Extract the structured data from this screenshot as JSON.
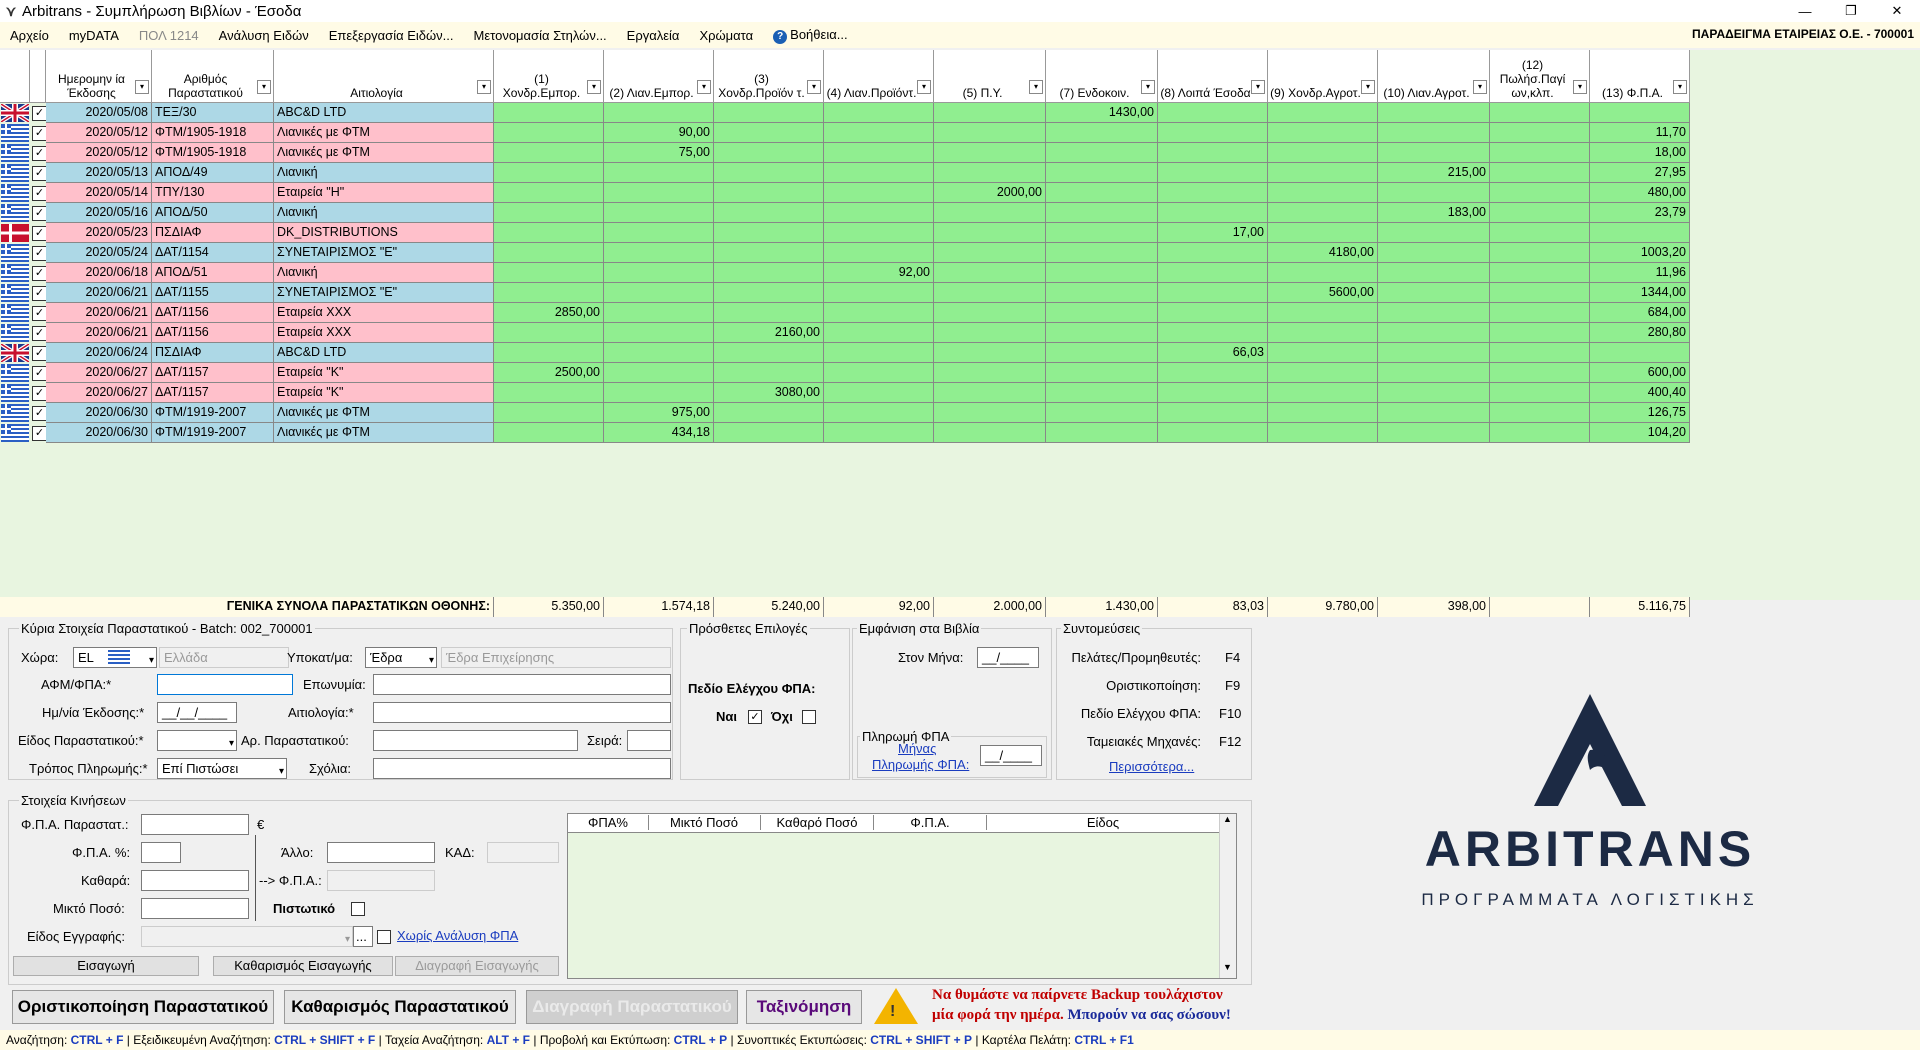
{
  "window": {
    "title": "Arbitrans - Συμπλήρωση Βιβλίων - Έσοδα",
    "minimize": "—",
    "maximize": "❐",
    "close": "✕"
  },
  "menu": [
    "Αρχείο",
    "myDATA",
    "ΠΟΛ 1214",
    "Ανάλυση Ειδών",
    "Επεξεργασία Ειδών...",
    "Μετονομασία Στηλών...",
    "Εργαλεία",
    "Χρώματα",
    "Βοήθεια..."
  ],
  "company": "ΠΑΡΑΔΕΙΓΜΑ ΕΤΑΙΡΕΙΑΣ Ο.Ε. - 700001",
  "grid": {
    "headers": [
      "Ημερομην ία Έκδοσης",
      "Αριθμός Παραστατικού",
      "Αιτιολογία",
      "(1) Χονδρ.Εμπορ.",
      "(2) Λιαν.Εμπορ.",
      "(3) Χονδρ.Προϊόν τ.",
      "(4) Λιαν.Προϊόντ.",
      "(5) Π.Υ.",
      "(7) Ενδοκοιν.",
      "(8) Λοιπά Έσοδα",
      "(9) Χονδρ.Αγροτ.",
      "(10) Λιαν.Αγροτ.",
      "(12) Πωλήσ.Παγί ων,κλπ.",
      "(13) Φ.Π.Α."
    ],
    "rows": [
      {
        "flag": "gb",
        "date": "2020/05/08",
        "doc": "ΤΕΞ/30",
        "desc": "ABC&D LTD",
        "vals": [
          "",
          "",
          "",
          "",
          "",
          "1430,00",
          "",
          "",
          "",
          "",
          ""
        ],
        "color": "blue"
      },
      {
        "flag": "gr",
        "date": "2020/05/12",
        "doc": "ΦΤΜ/1905-1918",
        "desc": "Λιανικές με ΦΤΜ",
        "vals": [
          "",
          "90,00",
          "",
          "",
          "",
          "",
          "",
          "",
          "",
          "",
          "11,70"
        ],
        "color": "pink"
      },
      {
        "flag": "gr",
        "date": "2020/05/12",
        "doc": "ΦΤΜ/1905-1918",
        "desc": "Λιανικές με ΦΤΜ",
        "vals": [
          "",
          "75,00",
          "",
          "",
          "",
          "",
          "",
          "",
          "",
          "",
          "18,00"
        ],
        "color": "pink"
      },
      {
        "flag": "gr",
        "date": "2020/05/13",
        "doc": "ΑΠΟΔ/49",
        "desc": "Λιανική",
        "vals": [
          "",
          "",
          "",
          "",
          "",
          "",
          "",
          "",
          "215,00",
          "",
          "27,95"
        ],
        "color": "blue"
      },
      {
        "flag": "gr",
        "date": "2020/05/14",
        "doc": "ΤΠΥ/130",
        "desc": "Εταιρεία \"Η\"",
        "vals": [
          "",
          "",
          "",
          "",
          "2000,00",
          "",
          "",
          "",
          "",
          "",
          "480,00"
        ],
        "color": "pink"
      },
      {
        "flag": "gr",
        "date": "2020/05/16",
        "doc": "ΑΠΟΔ/50",
        "desc": "Λιανική",
        "vals": [
          "",
          "",
          "",
          "",
          "",
          "",
          "",
          "",
          "183,00",
          "",
          "23,79"
        ],
        "color": "blue"
      },
      {
        "flag": "dk",
        "date": "2020/05/23",
        "doc": "ΠΣΔΙΑΦ",
        "desc": "DK_DISTRIBUTIONS",
        "vals": [
          "",
          "",
          "",
          "",
          "",
          "",
          "17,00",
          "",
          "",
          "",
          ""
        ],
        "color": "pink"
      },
      {
        "flag": "gr",
        "date": "2020/05/24",
        "doc": "ΔΑΤ/1154",
        "desc": "ΣΥΝΕΤΑΙΡΙΣΜΟΣ \"Ε\"",
        "vals": [
          "",
          "",
          "",
          "",
          "",
          "",
          "",
          "4180,00",
          "",
          "",
          "1003,20"
        ],
        "color": "blue"
      },
      {
        "flag": "gr",
        "date": "2020/06/18",
        "doc": "ΑΠΟΔ/51",
        "desc": "Λιανική",
        "vals": [
          "",
          "",
          "",
          "92,00",
          "",
          "",
          "",
          "",
          "",
          "",
          "11,96"
        ],
        "color": "pink"
      },
      {
        "flag": "gr",
        "date": "2020/06/21",
        "doc": "ΔΑΤ/1155",
        "desc": "ΣΥΝΕΤΑΙΡΙΣΜΟΣ \"Ε\"",
        "vals": [
          "",
          "",
          "",
          "",
          "",
          "",
          "",
          "5600,00",
          "",
          "",
          "1344,00"
        ],
        "color": "blue"
      },
      {
        "flag": "gr",
        "date": "2020/06/21",
        "doc": "ΔΑΤ/1156",
        "desc": "Εταιρεία ΧΧΧ",
        "vals": [
          "2850,00",
          "",
          "",
          "",
          "",
          "",
          "",
          "",
          "",
          "",
          "684,00"
        ],
        "color": "pink"
      },
      {
        "flag": "gr",
        "date": "2020/06/21",
        "doc": "ΔΑΤ/1156",
        "desc": "Εταιρεία ΧΧΧ",
        "vals": [
          "",
          "",
          "2160,00",
          "",
          "",
          "",
          "",
          "",
          "",
          "",
          "280,80"
        ],
        "color": "pink"
      },
      {
        "flag": "gb",
        "date": "2020/06/24",
        "doc": "ΠΣΔΙΑΦ",
        "desc": "ABC&D LTD",
        "vals": [
          "",
          "",
          "",
          "",
          "",
          "",
          "66,03",
          "",
          "",
          "",
          ""
        ],
        "color": "blue"
      },
      {
        "flag": "gr",
        "date": "2020/06/27",
        "doc": "ΔΑΤ/1157",
        "desc": "Εταιρεία \"Κ\"",
        "vals": [
          "2500,00",
          "",
          "",
          "",
          "",
          "",
          "",
          "",
          "",
          "",
          "600,00"
        ],
        "color": "pink"
      },
      {
        "flag": "gr",
        "date": "2020/06/27",
        "doc": "ΔΑΤ/1157",
        "desc": "Εταιρεία \"Κ\"",
        "vals": [
          "",
          "",
          "3080,00",
          "",
          "",
          "",
          "",
          "",
          "",
          "",
          "400,40"
        ],
        "color": "pink"
      },
      {
        "flag": "gr",
        "date": "2020/06/30",
        "doc": "ΦΤΜ/1919-2007",
        "desc": "Λιανικές με ΦΤΜ",
        "vals": [
          "",
          "975,00",
          "",
          "",
          "",
          "",
          "",
          "",
          "",
          "",
          "126,75"
        ],
        "color": "blue"
      },
      {
        "flag": "gr",
        "date": "2020/06/30",
        "doc": "ΦΤΜ/1919-2007",
        "desc": "Λιανικές με ΦΤΜ",
        "vals": [
          "",
          "434,18",
          "",
          "",
          "",
          "",
          "",
          "",
          "",
          "",
          "104,20"
        ],
        "color": "blue"
      }
    ],
    "totals_label": "ΓΕΝΙΚΑ ΣΥΝΟΛΑ ΠΑΡΑΣΤΑΤΙΚΩΝ ΟΘΟΝΗΣ:",
    "totals": [
      "5.350,00",
      "1.574,18",
      "5.240,00",
      "92,00",
      "2.000,00",
      "1.430,00",
      "83,03",
      "9.780,00",
      "398,00",
      "",
      "5.116,75"
    ]
  },
  "main_form": {
    "title": "Κύρια Στοιχεία Παραστατικού - Batch: 002_700001",
    "country_label": "Χώρα:",
    "country_value": "EL",
    "country_name": "Ελλάδα",
    "branch_label": "Υποκατ/μα:",
    "branch_value": "Έδρα",
    "branch_placeholder": "Έδρα Επιχείρησης",
    "afm_label": "ΑΦΜ/ΦΠΑ:*",
    "name_label": "Επωνυμία:",
    "date_label": "Ημ/νία Έκδοσης:*",
    "date_value": "__/__/____",
    "reason_label": "Αιτιολογία:*",
    "doctype_label": "Είδος Παραστατικού:*",
    "docnum_label": "Αρ. Παραστατικού:",
    "series_label": "Σειρά:",
    "payment_label": "Τρόπος Πληρωμής:*",
    "payment_value": "Επί Πιστώσει",
    "notes_label": "Σχόλια:"
  },
  "extra": {
    "title": "Πρόσθετες Επιλογές",
    "vat_check_label": "Πεδίο Ελέγχου ΦΠΑ:",
    "yes": "Ναι",
    "no": "Όχι"
  },
  "books": {
    "title": "Εμφάνιση στα Βιβλία",
    "month_label": "Στον Μήνα:",
    "month_value": "__/____",
    "vatpay_title": "Πληρωμή ΦΠΑ",
    "vatpay_link1": "Μήνας",
    "vatpay_link2": "Πληρωμής ΦΠΑ:",
    "vatpay_value": "__/____"
  },
  "shortcuts": {
    "title": "Συντομεύσεις",
    "items": [
      {
        "label": "Πελάτες/Προμηθευτές:",
        "key": "F4"
      },
      {
        "label": "Οριστικοποίηση:",
        "key": "F9"
      },
      {
        "label": "Πεδίο Ελέγχου ΦΠΑ:",
        "key": "F10"
      },
      {
        "label": "Ταμειακές Μηχανές:",
        "key": "F12"
      }
    ],
    "more": "Περισσότερα..."
  },
  "movements": {
    "title": "Στοιχεία Κινήσεων",
    "vat_doc_label": "Φ.Π.Α. Παραστατ.:",
    "euro": "€",
    "vat_pct_label": "Φ.Π.Α. %:",
    "other_label": "Άλλο:",
    "kad_label": "ΚΑΔ:",
    "net_label": "Καθαρά:",
    "arrow_vat_label": "--> Φ.Π.Α.:",
    "gross_label": "Μικτό Ποσό:",
    "credit_label": "Πιστωτικό",
    "entry_type_label": "Είδος Εγγραφής:",
    "ellipsis": "...",
    "no_vat_link": "Χωρίς Ανάλυση ΦΠΑ",
    "btn_insert": "Εισαγωγή",
    "btn_clear_insert": "Καθαρισμός Εισαγωγής",
    "btn_delete_insert": "Διαγραφή Εισαγωγής",
    "table_headers": [
      "ΦΠΑ%",
      "Μικτό Ποσό",
      "Καθαρό Ποσό",
      "Φ.Π.Α.",
      "Είδος"
    ]
  },
  "buttons": {
    "finalize": "Οριστικοποίηση Παραστατικού",
    "clear": "Καθαρισμός Παραστατικού",
    "delete": "Διαγραφή Παραστατικού",
    "sort": "Ταξινόμηση"
  },
  "backup": {
    "line1": "Να θυμάστε να παίρνετε Backup τουλάχιστον",
    "line2a": "μία φορά την ημέρα.",
    "line2b": "Μπορούν να σας σώσουν!"
  },
  "logo": {
    "brand": "ARBITRANS",
    "tagline": "ΠΡΟΓΡΑΜΜΑΤΑ ΛΟΓΙΣΤΙΚΗΣ"
  },
  "footer": [
    {
      "label": "Αναζήτηση:",
      "key": "CTRL + F"
    },
    {
      "label": "Εξειδικευμένη Αναζήτηση:",
      "key": "CTRL + SHIFT + F"
    },
    {
      "label": "Ταχεία Αναζήτηση:",
      "key": "ALT + F"
    },
    {
      "label": "Προβολή και Εκτύπωση:",
      "key": "CTRL + P"
    },
    {
      "label": "Συνοπτικές Εκτυπώσεις:",
      "key": "CTRL + SHIFT + P"
    },
    {
      "label": "Καρτέλα Πελάτη:",
      "key": "CTRL + F1"
    }
  ],
  "colors": {
    "row_blue": "#add8e6",
    "row_pink": "#ffc0cb",
    "amount_green": "#90ee90",
    "grid_bg": "#e8f5e0"
  }
}
